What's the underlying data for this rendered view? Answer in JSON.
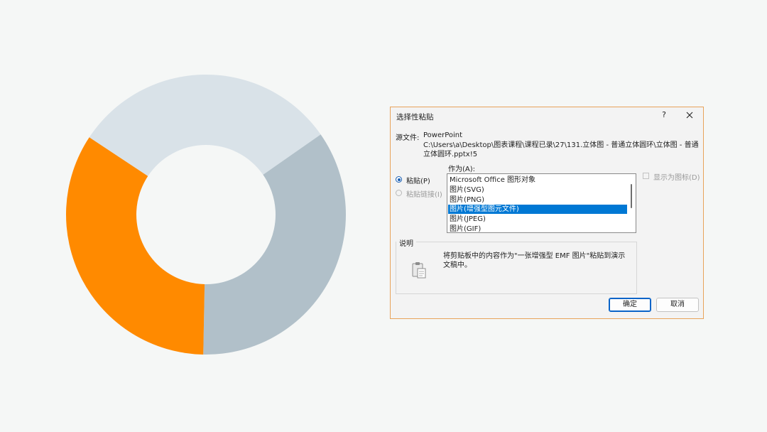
{
  "chart_data": {
    "type": "pie",
    "style": "donut",
    "slices": [
      {
        "value": 31,
        "color": "#d9e2e8"
      },
      {
        "value": 35,
        "color": "#b1c0c9"
      },
      {
        "value": 34,
        "color": "#ff8a00"
      }
    ]
  },
  "dialog": {
    "title": "选择性粘贴",
    "help_label": "?",
    "source_label": "源文件:",
    "source_app": "PowerPoint",
    "source_path": "C:\\Users\\a\\Desktop\\图表课程\\课程已录\\27\\131.立体图 - 普通立体圆环\\立体图 - 普通立体圆环.pptx!5",
    "as_label": "作为(A):",
    "paste_label": "粘贴(P)",
    "paste_link_label": "粘贴链接(I)",
    "list_items": [
      "Microsoft Office 图形对象",
      "图片(SVG)",
      "图片(PNG)",
      "图片(增强型图元文件)",
      "图片(JPEG)",
      "图片(GIF)"
    ],
    "selected_index": 3,
    "display_as_icon_label": "显示为图标(D)",
    "description_title": "说明",
    "description_text": "将剪贴板中的内容作为\"一张增强型 EMF 图片\"粘贴到演示文稿中。",
    "ok_label": "确定",
    "cancel_label": "取消"
  }
}
